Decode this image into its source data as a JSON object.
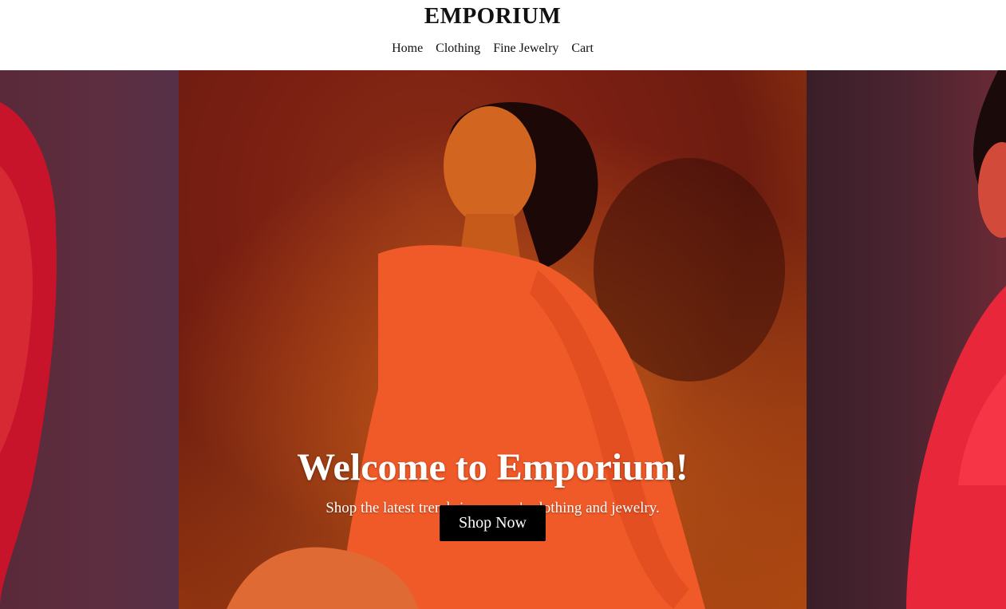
{
  "brand": "EMPORIUM",
  "nav": {
    "items": [
      "Home",
      "Clothing",
      "Fine Jewelry",
      "Cart"
    ]
  },
  "hero": {
    "title": "Welcome to Emporium!",
    "subtitle": "Shop the latest trends in women's clothing and jewelry.",
    "cta_label": "Shop Now"
  },
  "colors": {
    "cta_bg": "#000000",
    "cta_text": "#ffffff",
    "header_bg": "#ffffff",
    "text_dark": "#111111"
  }
}
